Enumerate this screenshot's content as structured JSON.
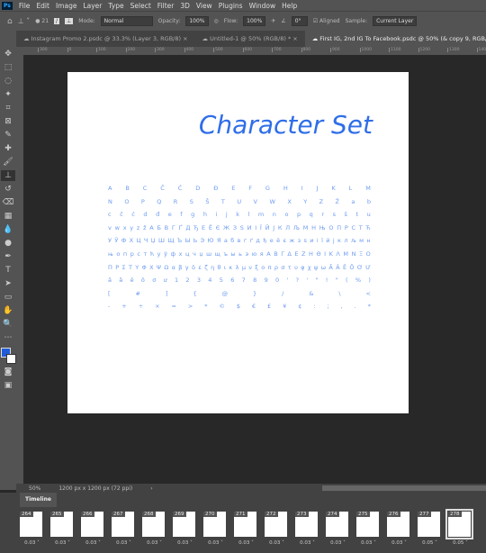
{
  "menu": {
    "logo": "Ps",
    "items": [
      "File",
      "Edit",
      "Image",
      "Layer",
      "Type",
      "Select",
      "Filter",
      "3D",
      "View",
      "Plugins",
      "Window",
      "Help"
    ]
  },
  "options": {
    "brush_size": "21",
    "mode_label": "Mode:",
    "mode_value": "Normal",
    "opacity_label": "Opacity:",
    "opacity_value": "100%",
    "flow_label": "Flow:",
    "flow_value": "100%",
    "angle_value": "0°",
    "aligned_label": "Aligned",
    "aligned_checked": true,
    "sample_label": "Sample:",
    "sample_value": "Current Layer"
  },
  "tabs": [
    "Instagram Promo 2.psdc @ 33.3% (Layer 3, RGB/8)",
    "Untitled-1 @ 50% (RGB/8) *",
    "First IG, 2nd IG To Facebook.psdc @ 50% (& copy 9, RGB/8)"
  ],
  "ruler": [
    "300",
    "0",
    "100",
    "200",
    "300",
    "400",
    "500",
    "600",
    "700",
    "800",
    "900",
    "1000",
    "1100",
    "1200",
    "1300",
    "1400"
  ],
  "document": {
    "title": "Character Set",
    "rows": [
      "A B C Č Ć D Đ E F G H I J K L M",
      "N O P Q R S Š T U V W X Y Z Ž a b",
      "c č ć d đ e f g h i j k l m n o p q r s š t u",
      "v w x y z ž А Б В Г Ґ Д Ђ Е Ё Є Ж З Ѕ И І Ї Й Ј К Л Љ М Н Њ О П Р С Т Ћ",
      "У Ў Ф Х Ц Ч Џ Ш Щ Ъ Ы Ь Э Ю Я а б в г ґ д ђ е ё є ж з ѕ и і ї й ј к л љ м н",
      "њ о п р с т ћ у ў ф х ц ч џ ш щ ъ ы ь э ю я Α Β Γ Δ Ε Ζ Η Θ Ι Κ Λ Μ Ν Ξ Ο",
      "Π Ρ Σ Τ Υ Φ Χ Ψ Ω α β γ δ ε ζ η θ ι κ λ μ ν ξ ο π ρ σ τ υ φ χ ψ ω Ă Â Ê Ô Ơ Ư",
      "ă â ê ô ơ ư 1 2 3 4 5 6 7 8 9 0 ' ? ' \" ! \" ( % )",
      "[ # ] { @ } / & \\ <",
      "- + ÷ × = > * © $ € £ ¥ ¢ : ; , . *"
    ],
    "text_color": "#2f6ee8"
  },
  "status": {
    "zoom": "50%",
    "size": "1200 px x 1200 px (72 ppi)"
  },
  "timeline": {
    "label": "Timeline",
    "frames": [
      {
        "n": "264",
        "d": "0.03"
      },
      {
        "n": "265",
        "d": "0.03"
      },
      {
        "n": "266",
        "d": "0.03"
      },
      {
        "n": "267",
        "d": "0.03"
      },
      {
        "n": "268",
        "d": "0.03"
      },
      {
        "n": "269",
        "d": "0.03"
      },
      {
        "n": "270",
        "d": "0.03"
      },
      {
        "n": "271",
        "d": "0.03"
      },
      {
        "n": "272",
        "d": "0.03"
      },
      {
        "n": "273",
        "d": "0.03"
      },
      {
        "n": "274",
        "d": "0.03"
      },
      {
        "n": "275",
        "d": "0.03"
      },
      {
        "n": "276",
        "d": "0.03"
      },
      {
        "n": "277",
        "d": "0.05"
      },
      {
        "n": "278",
        "d": "0.05",
        "selected": true
      }
    ]
  },
  "colors": {
    "foreground": "#1f5bd6",
    "background": "#ffffff"
  }
}
